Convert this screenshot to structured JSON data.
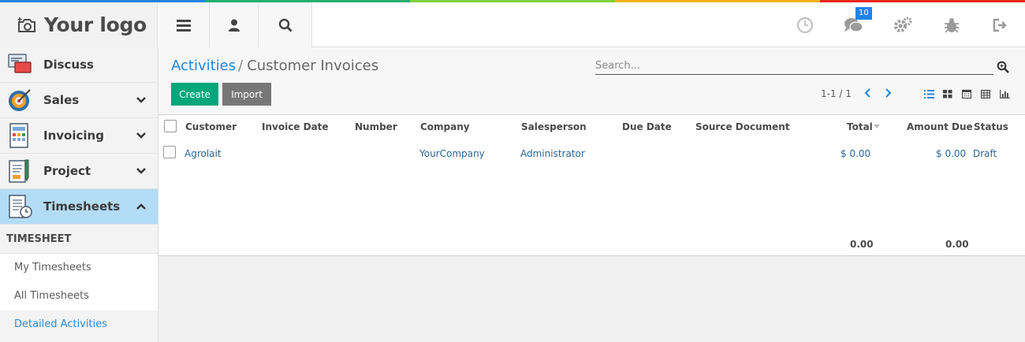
{
  "colors": {
    "stripe": [
      "#1f83e6",
      "#1bb06e",
      "#7ed03a",
      "#f0b41a",
      "#e8271b"
    ],
    "accent": "#1f86d8",
    "create": "#00a77a",
    "import": "#777777"
  },
  "header": {
    "logo_text": "Your logo",
    "buttons": [
      {
        "icon": "hamburger-icon"
      },
      {
        "icon": "user-icon"
      },
      {
        "icon": "search-icon"
      }
    ],
    "right_icons": [
      {
        "icon": "clock-icon"
      },
      {
        "icon": "chat-icon",
        "badge": "10"
      },
      {
        "icon": "gears-icon"
      },
      {
        "icon": "bug-icon"
      },
      {
        "icon": "logout-icon"
      }
    ]
  },
  "sidebar": {
    "items": [
      {
        "label": "Discuss",
        "icon": "discuss-icon"
      },
      {
        "label": "Sales",
        "icon": "sales-target-icon"
      },
      {
        "label": "Invoicing",
        "icon": "invoicing-icon"
      },
      {
        "label": "Project",
        "icon": "project-icon"
      },
      {
        "label": "Timesheets",
        "icon": "timesheets-icon"
      }
    ],
    "section_title": "TIMESHEET",
    "sub_items": [
      {
        "label": "My Timesheets"
      },
      {
        "label": "All Timesheets"
      },
      {
        "label": "Detailed Activities"
      }
    ]
  },
  "breadcrumb": {
    "parent": "Activities",
    "separator": "/",
    "current": "Customer Invoices"
  },
  "search": {
    "placeholder": "Search..."
  },
  "toolbar": {
    "create_label": "Create",
    "import_label": "Import"
  },
  "pager": {
    "text": "1-1 / 1"
  },
  "views": [
    "list-view-icon",
    "kanban-view-icon",
    "calendar-view-icon",
    "pivot-view-icon",
    "graph-view-icon"
  ],
  "table": {
    "columns": [
      "Customer",
      "Invoice Date",
      "Number",
      "Company",
      "Salesperson",
      "Due Date",
      "Source Document",
      "Total",
      "Amount Due",
      "Status"
    ],
    "rows": [
      {
        "customer": "Agrolait",
        "invoice_date": "",
        "number": "",
        "company": "YourCompany",
        "salesperson": "Administrator",
        "due_date": "",
        "source_document": "",
        "total": "$ 0.00",
        "amount_due": "$ 0.00",
        "status": "Draft"
      }
    ],
    "footer": {
      "total": "0.00",
      "amount_due": "0.00"
    }
  }
}
